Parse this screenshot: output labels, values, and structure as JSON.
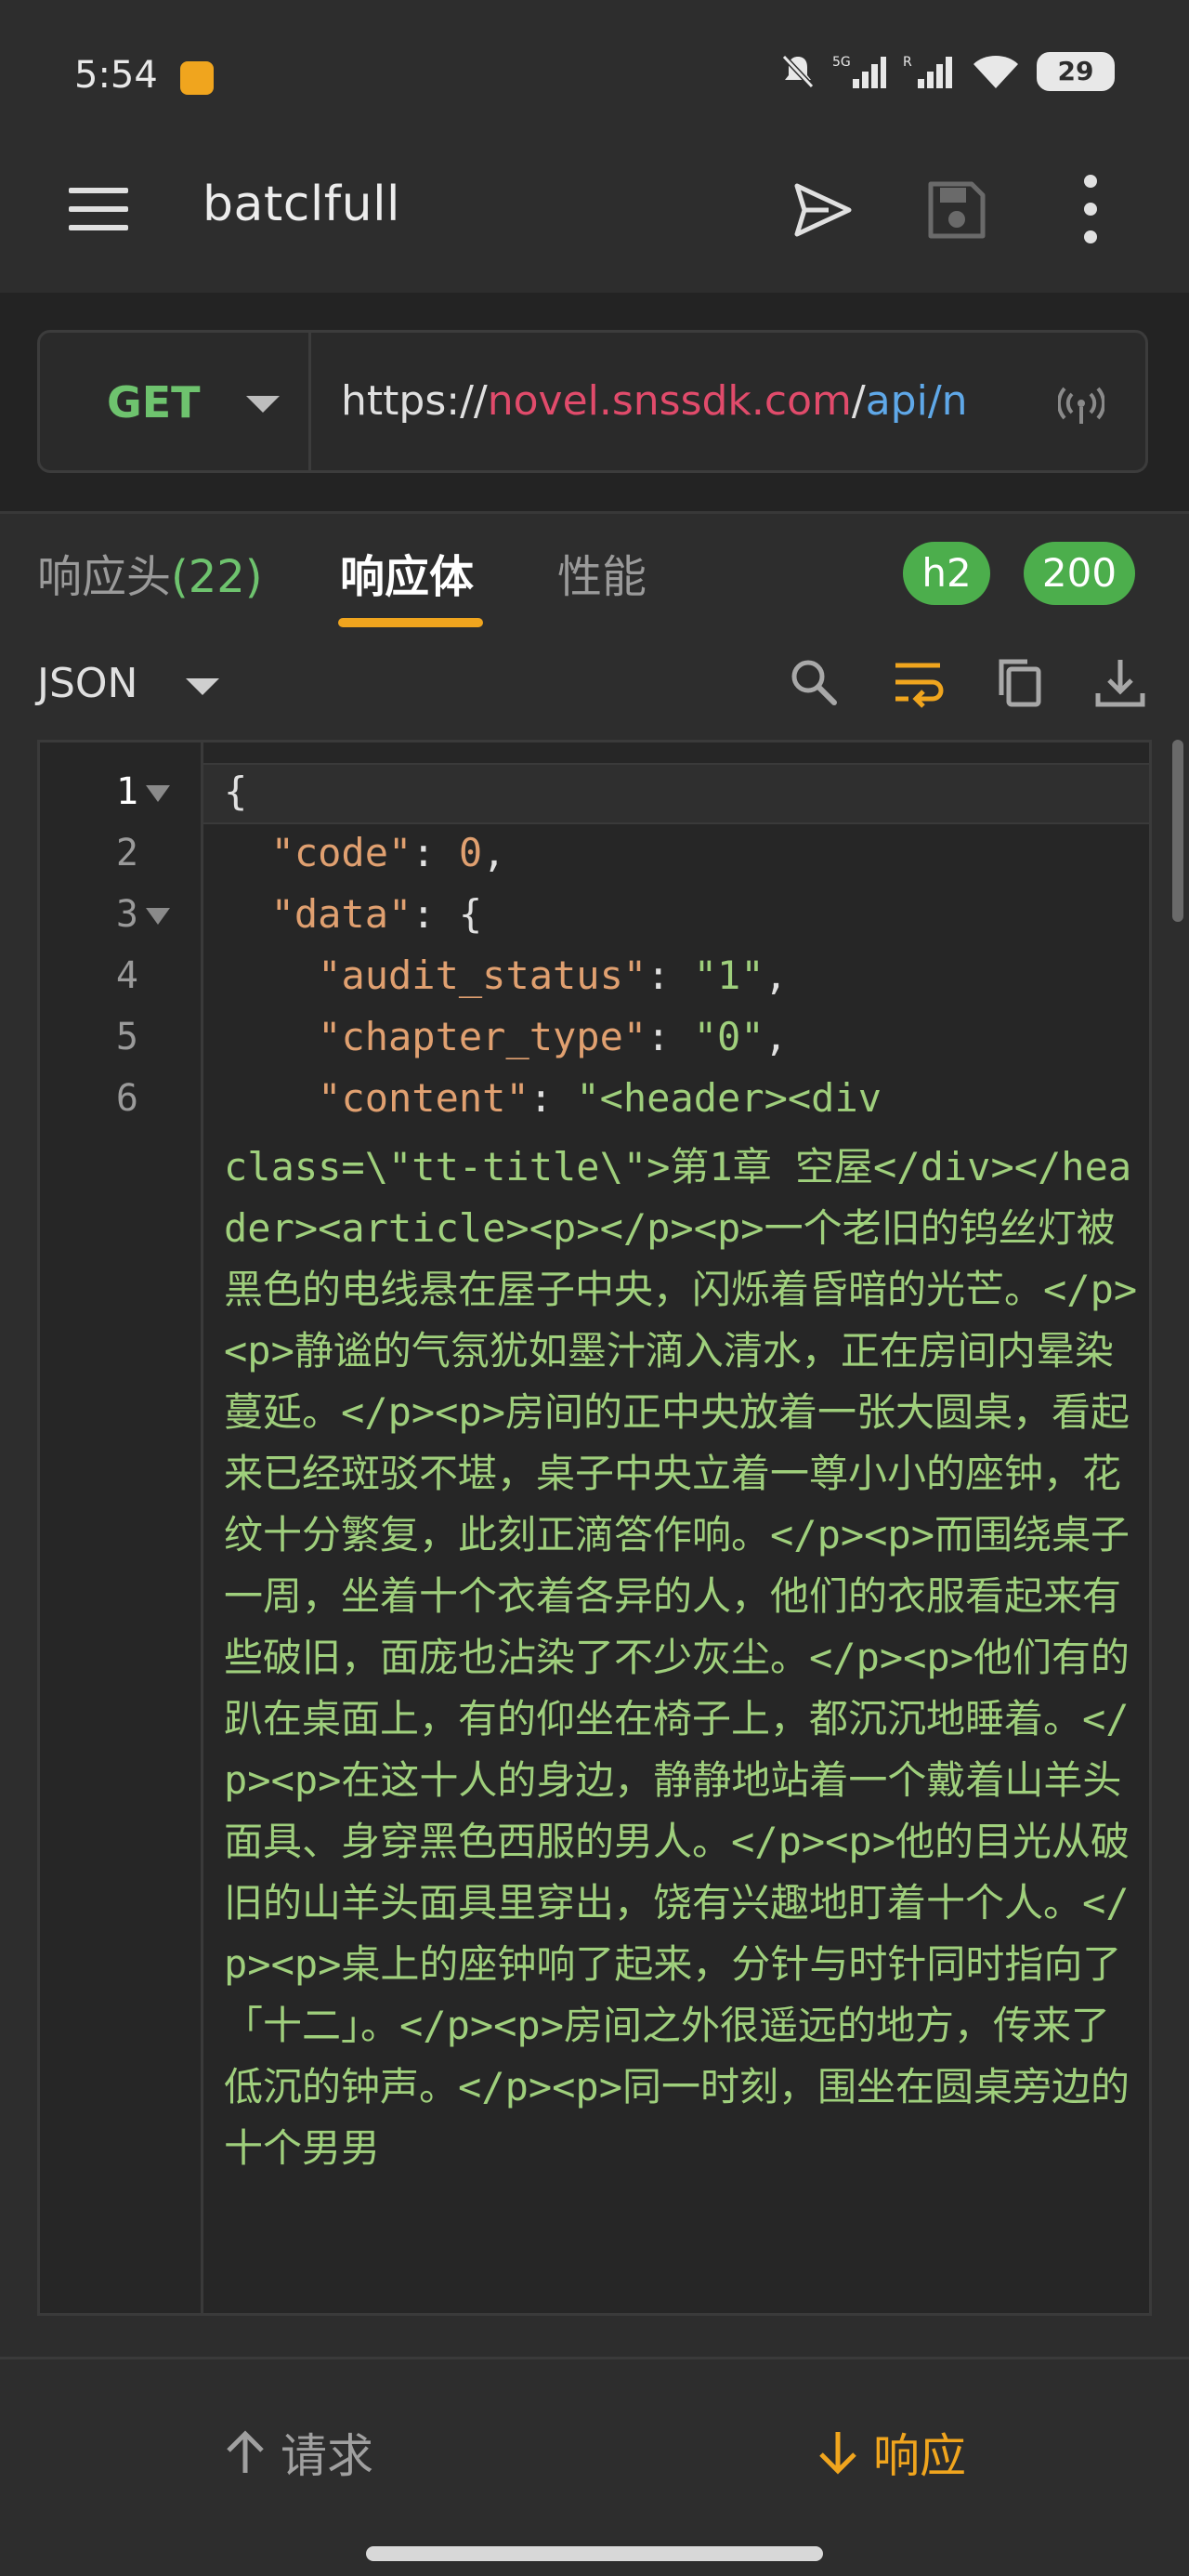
{
  "status_bar": {
    "time": "5:54",
    "icons": [
      "notification-app-icon",
      "mute-icon",
      "5g-signal-icon",
      "signal-icon",
      "wifi-icon",
      "battery-icon"
    ],
    "battery": "29"
  },
  "app_bar": {
    "title": "batclfull",
    "icons": [
      "menu-icon",
      "send-icon",
      "save-icon",
      "more-icon"
    ]
  },
  "request": {
    "method": "GET",
    "url_scheme": "https://",
    "url_host": "novel.snssdk.com",
    "url_sep": "/",
    "url_path": "api/n"
  },
  "tabs": {
    "headers_label": "响应头",
    "headers_count": "(22)",
    "body_label": "响应体",
    "perf_label": "性能",
    "protocol_badge": "h2",
    "status_badge": "200"
  },
  "toolbar": {
    "format": "JSON"
  },
  "editor": {
    "line_numbers": [
      "1",
      "2",
      "3",
      "4",
      "5",
      "6"
    ],
    "line1": "{",
    "line2_key": "\"code\"",
    "line2_colon": ": ",
    "line2_val": "0",
    "line2_end": ",",
    "line3_key": "\"data\"",
    "line3_rest": ": {",
    "line4_key": "\"audit_status\"",
    "line4_colon": ": ",
    "line4_val": "\"1\"",
    "line4_end": ",",
    "line5_key": "\"chapter_type\"",
    "line5_colon": ": ",
    "line5_val": "\"0\"",
    "line5_end": ",",
    "line6_key": "\"content\"",
    "line6_colon": ": ",
    "line6_val_start": "\"<header><div",
    "content_wrapped": "class=\\\"tt-title\\\">第1章 空屋</div></header><article><p></p><p>一个老旧的钨丝灯被黑色的电线悬在屋子中央，闪烁着昏暗的光芒。</p><p>静谧的气氛犹如墨汁滴入清水，正在房间内晕染蔓延。</p><p>房间的正中央放着一张大圆桌，看起来已经斑驳不堪，桌子中央立着一尊小小的座钟，花纹十分繁复，此刻正滴答作响。</p><p>而围绕桌子一周，坐着十个衣着各异的人，他们的衣服看起来有些破旧，面庞也沾染了不少灰尘。</p><p>他们有的趴在桌面上，有的仰坐在椅子上，都沉沉地睡着。</p><p>在这十人的身边，静静地站着一个戴着山羊头面具、身穿黑色西服的男人。</p><p>他的目光从破旧的山羊头面具里穿出，饶有兴趣地盯着十个人。</p><p>桌上的座钟响了起来，分针与时针同时指向了「十二」。</p><p>房间之外很遥远的地方，传来了低沉的钟声。</p><p>同一时刻，围坐在圆桌旁边的十个男男"
  },
  "bottom_nav": {
    "request_label": "请求",
    "response_label": "响应"
  },
  "colors": {
    "accent": "#f0a51e",
    "method": "#6ec36e",
    "url_host": "#e14b6b",
    "url_path": "#5fa8e8",
    "badge": "#4cae4c",
    "json_key": "#e0a070",
    "json_string": "#9fcf7c"
  }
}
